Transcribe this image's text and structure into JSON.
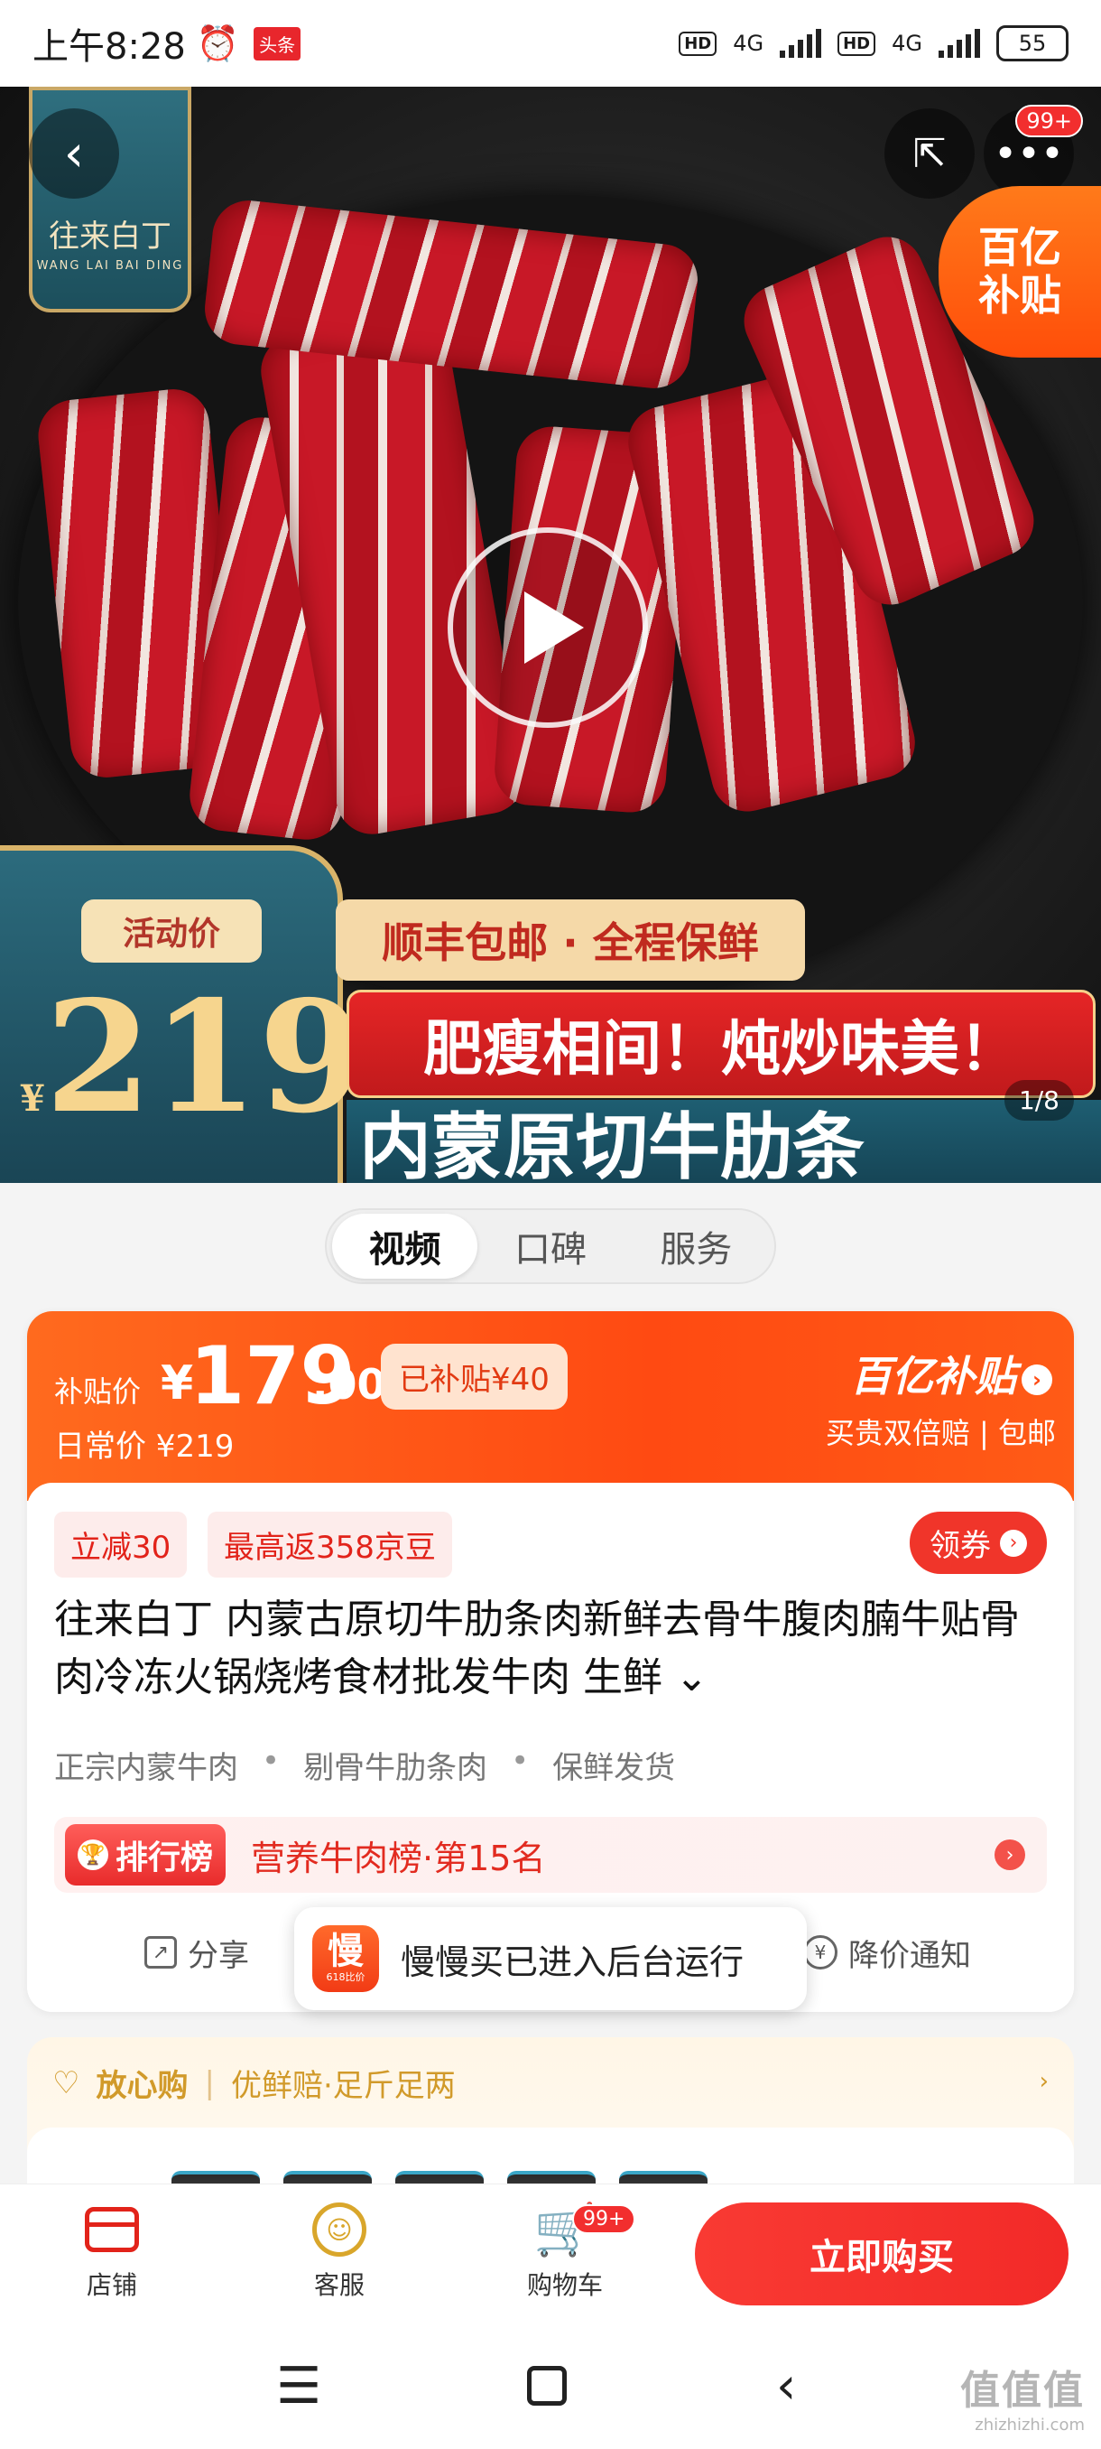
{
  "status_bar": {
    "time": "上午8:28",
    "news_badge": "头条",
    "hd1": "HD",
    "net1": "4G",
    "hd2": "HD",
    "net2": "4G",
    "battery": "55"
  },
  "hero": {
    "brand_logo": "往来白丁",
    "brand_pinyin": "WANG LAI BAI DING",
    "notification_badge": "99+",
    "subsidy_corner": [
      "百亿",
      "补贴"
    ],
    "activity_label": "活动价",
    "activity_currency": "¥",
    "activity_price": "219",
    "shipping_banner": "顺丰包邮 · 全程保鲜",
    "slogan_banner": "肥瘦相间！炖炒味美！",
    "title_banner": "内蒙原切牛肋条",
    "image_counter": "1/8"
  },
  "media_tabs": [
    {
      "label": "视频",
      "active": true
    },
    {
      "label": "口碑",
      "active": false
    },
    {
      "label": "服务",
      "active": false
    }
  ],
  "price": {
    "subsidy_label": "补贴价",
    "currency": "¥",
    "amount": "179",
    "decimal": ".00",
    "subsidized": "已补贴¥40",
    "regular": "日常价 ¥219",
    "subsidy_brand": "百亿补贴",
    "subsidy_desc": "买贵双倍赔 | 包邮"
  },
  "promo": {
    "chip1": "立减30",
    "chip2": "最高返358京豆",
    "coupon": "领券"
  },
  "product": {
    "title": "往来白丁 内蒙古原切牛肋条肉新鲜去骨牛腹肉腩牛贴骨肉冷冻火锅烧烤食材批发牛肉 生鲜",
    "features": [
      "正宗内蒙牛肉",
      "剔骨牛肋条肉",
      "保鲜发货"
    ]
  },
  "ranking": {
    "tag": "排行榜",
    "text": "营养牛肉榜·第15名"
  },
  "actions": {
    "share": "分享",
    "price_alert": "降价通知"
  },
  "toast": {
    "app_glyph": "慢",
    "app_sub": "618比价",
    "message": "慢慢买已进入后台运行"
  },
  "assurance": {
    "title": "放心购",
    "detail": "优鲜赔·足斤足两"
  },
  "bottom_nav": {
    "shop": "店铺",
    "service": "客服",
    "cart": "购物车",
    "cart_badge": "99+",
    "buy_now": "立即购买"
  },
  "watermark": {
    "big": "值值值",
    "small": "zhizhizhi.com"
  },
  "colors": {
    "accent": "#f22a28",
    "subsidy_orange": "#ff4a12",
    "assurance_gold": "#d19a2a"
  }
}
